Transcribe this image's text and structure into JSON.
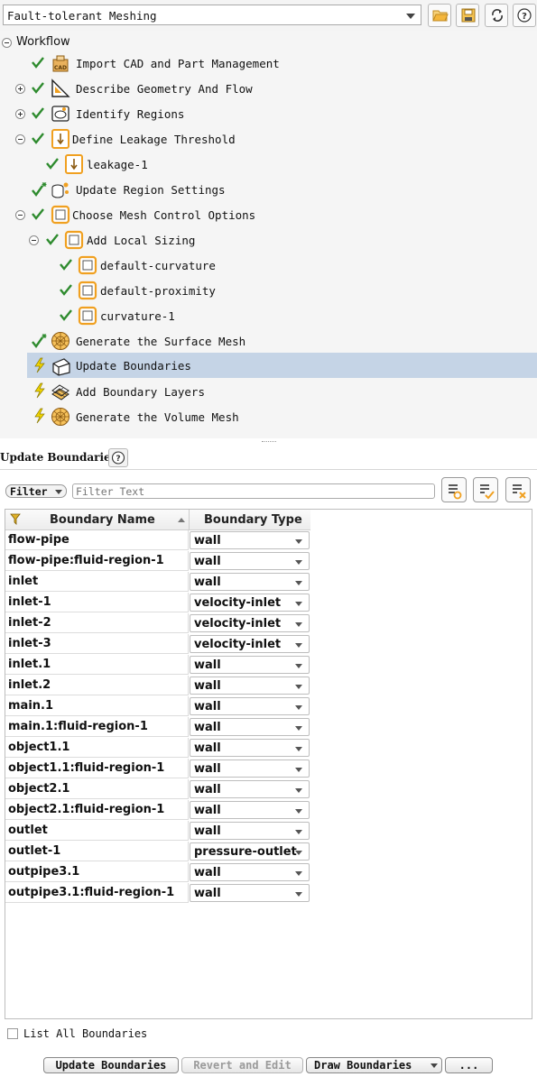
{
  "toolbar": {
    "workflow_value": "Fault-tolerant Meshing",
    "buttons": [
      "open-icon",
      "save-icon",
      "refresh-icon",
      "help-icon"
    ]
  },
  "tree": {
    "root_label": "Workflow",
    "items": [
      {
        "label": "Import CAD and Part Management",
        "status": "done",
        "icon": "cad-icon"
      },
      {
        "label": "Describe Geometry And Flow",
        "status": "done",
        "icon": "geometry-icon"
      },
      {
        "label": "Identify Regions",
        "status": "done",
        "icon": "regions-icon"
      },
      {
        "label": "Define Leakage Threshold",
        "status": "done",
        "icon": "leakage-icon"
      },
      {
        "label": "leakage-1",
        "status": "done",
        "icon": "leakage-icon"
      },
      {
        "label": "Update Region Settings",
        "status": "done-updated",
        "icon": "region-settings-icon"
      },
      {
        "label": "Choose Mesh Control Options",
        "status": "done",
        "icon": "mesh-control-icon"
      },
      {
        "label": "Add Local Sizing",
        "status": "done",
        "icon": "mesh-control-icon"
      },
      {
        "label": "default-curvature",
        "status": "done",
        "icon": "mesh-control-icon"
      },
      {
        "label": "default-proximity",
        "status": "done",
        "icon": "mesh-control-icon"
      },
      {
        "label": "curvature-1",
        "status": "done",
        "icon": "mesh-control-icon"
      },
      {
        "label": "Generate the Surface Mesh",
        "status": "done-updated",
        "icon": "surface-mesh-icon"
      },
      {
        "label": "Update Boundaries",
        "status": "pending",
        "icon": "boundaries-icon"
      },
      {
        "label": "Add Boundary Layers",
        "status": "pending",
        "icon": "boundary-layers-icon"
      },
      {
        "label": "Generate the Volume Mesh",
        "status": "pending",
        "icon": "volume-mesh-icon"
      }
    ]
  },
  "panel": {
    "title": "Update Boundaries",
    "filter_label": "Filter",
    "filter_placeholder": "Filter Text",
    "columns": [
      "Boundary Name",
      "Boundary Type"
    ],
    "rows": [
      {
        "name": "flow-pipe",
        "type": "wall"
      },
      {
        "name": "flow-pipe:fluid-region-1",
        "type": "wall"
      },
      {
        "name": "inlet",
        "type": "wall"
      },
      {
        "name": "inlet-1",
        "type": "velocity-inlet"
      },
      {
        "name": "inlet-2",
        "type": "velocity-inlet"
      },
      {
        "name": "inlet-3",
        "type": "velocity-inlet"
      },
      {
        "name": "inlet.1",
        "type": "wall"
      },
      {
        "name": "inlet.2",
        "type": "wall"
      },
      {
        "name": "main.1",
        "type": "wall"
      },
      {
        "name": "main.1:fluid-region-1",
        "type": "wall"
      },
      {
        "name": "object1.1",
        "type": "wall"
      },
      {
        "name": "object1.1:fluid-region-1",
        "type": "wall"
      },
      {
        "name": "object2.1",
        "type": "wall"
      },
      {
        "name": "object2.1:fluid-region-1",
        "type": "wall"
      },
      {
        "name": "outlet",
        "type": "wall"
      },
      {
        "name": "outlet-1",
        "type": "pressure-outlet"
      },
      {
        "name": "outpipe3.1",
        "type": "wall"
      },
      {
        "name": "outpipe3.1:fluid-region-1",
        "type": "wall"
      }
    ],
    "list_all_label": "List All Boundaries",
    "list_all_checked": false
  },
  "buttons": {
    "update": "Update Boundaries",
    "revert": "Revert and Edit",
    "draw": "Draw Boundaries",
    "more": "..."
  },
  "colors": {
    "check": "#2e8b2e",
    "pending": "#f2d600",
    "selection": "#c5d4e6",
    "icon_orange": "#f0a020"
  }
}
